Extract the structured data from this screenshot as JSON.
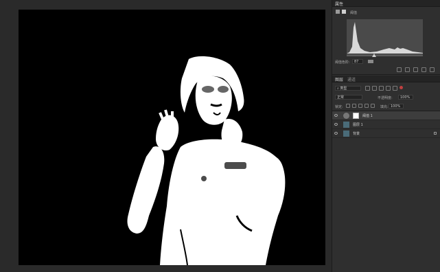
{
  "properties_panel": {
    "tab_title": "属性",
    "section_label": "阈值",
    "threshold_label": "阈值色阶:",
    "threshold_value": "87"
  },
  "layers_panel": {
    "tabs": [
      "图层",
      "通道"
    ],
    "filter_kind": "类型",
    "blend_mode": "正常",
    "opacity_label": "不透明度:",
    "opacity_value": "100%",
    "lock_label": "锁定:",
    "fill_label": "填充:",
    "fill_value": "100%",
    "layers": [
      {
        "name": "阈值 1"
      },
      {
        "name": "图层 1"
      },
      {
        "name": "背景"
      }
    ]
  }
}
